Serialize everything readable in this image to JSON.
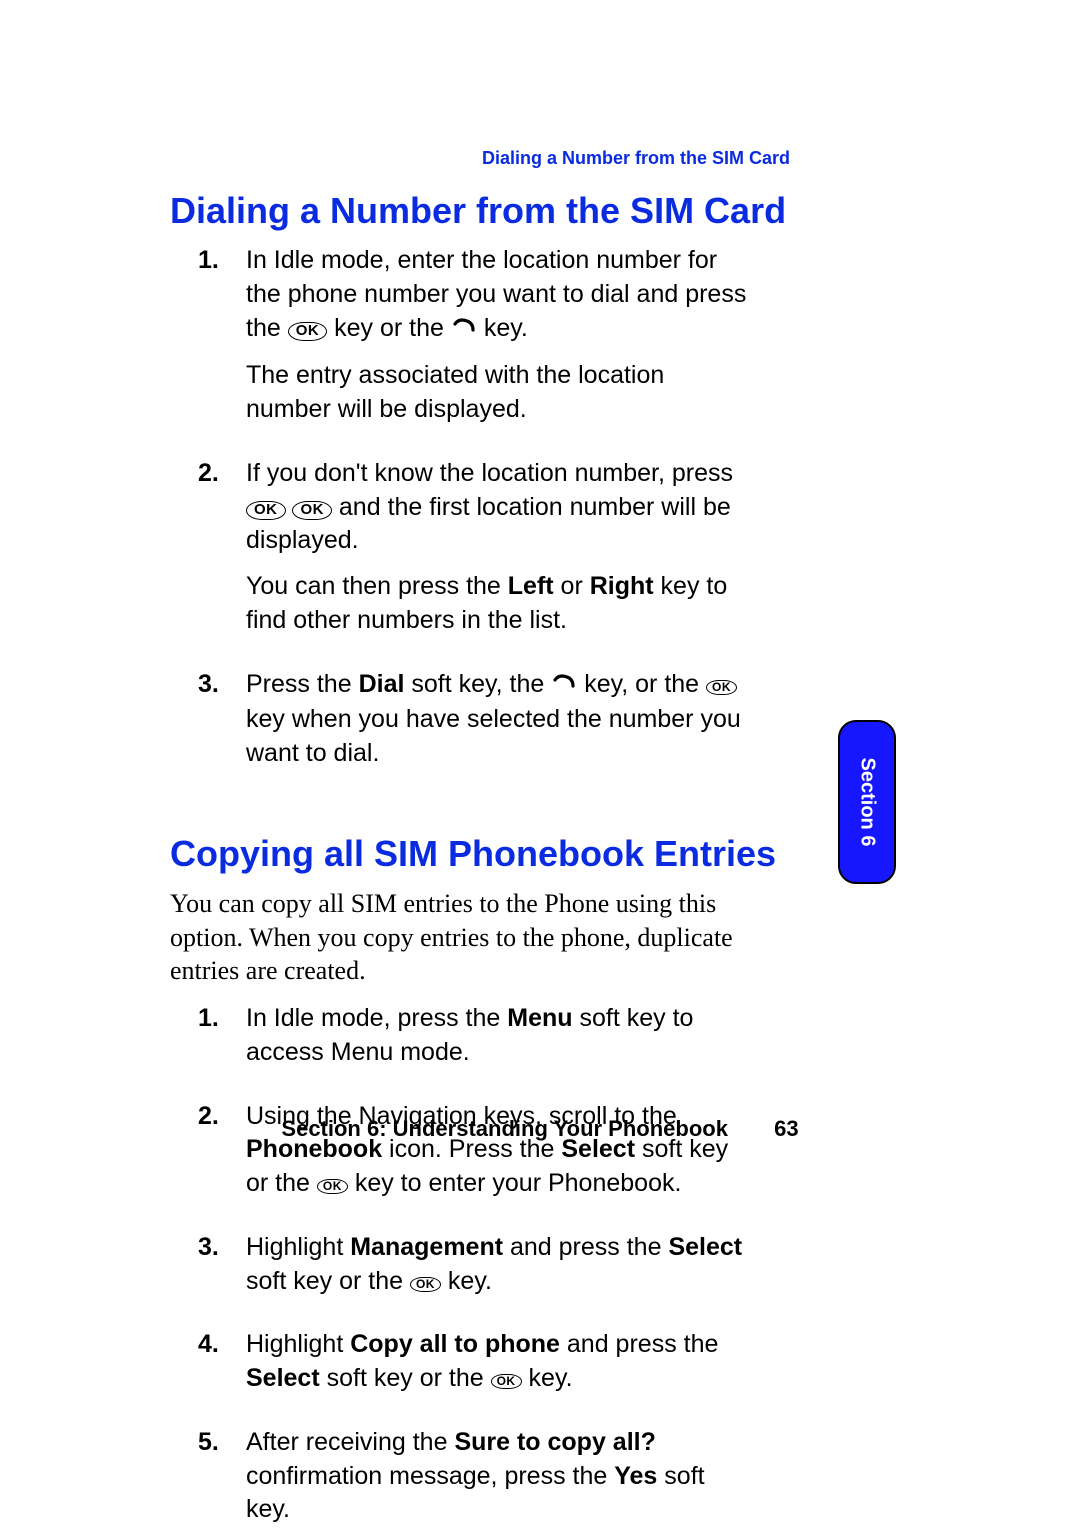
{
  "running_head": "Dialing a Number from the SIM Card",
  "section_tab": "Section 6",
  "footer_title": "Section 6: Understanding Your Phonebook",
  "footer_page": "63",
  "sec1": {
    "title": "Dialing a Number from the SIM Card",
    "steps": {
      "n1": "1.",
      "s1a": "In Idle mode, enter the location number for the phone number you want to dial and press the ",
      "s1b": " key or the ",
      "s1c": " key.",
      "s1d": "The entry associated with the location number will be displayed.",
      "n2": "2.",
      "s2a": "If you don't know the location number, press ",
      "s2b": " and the first location number will be displayed.",
      "s2c_a": "You can then press the ",
      "s2c_left": "Left",
      "s2c_or": " or ",
      "s2c_right": "Right",
      "s2c_b": " key to find other numbers in the list.",
      "n3": "3.",
      "s3a": "Press the ",
      "s3_dial": "Dial",
      "s3b": " soft key, the ",
      "s3c": " key, or the  ",
      "s3d": " key when you have selected the number you want to dial."
    }
  },
  "sec2": {
    "title": "Copying all SIM Phonebook Entries",
    "intro": "You can copy all SIM entries to the Phone using this option. When you copy entries to the phone, duplicate entries are created.",
    "steps": {
      "n1": "1.",
      "s1a": "In Idle mode, press the ",
      "s1_menu": "Menu",
      "s1b": " soft key to access Menu mode.",
      "n2": "2.",
      "s2a": "Using the Navigation keys, scroll to the ",
      "s2_pb": "Phonebook",
      "s2b": " icon. Press the ",
      "s2_sel": "Select",
      "s2c": " soft key or the ",
      "s2d": " key to enter your Phonebook.",
      "n3": "3.",
      "s3a": "Highlight ",
      "s3_mg": "Management",
      "s3b": " and press the ",
      "s3_sel": "Select",
      "s3c": " soft key or the ",
      "s3d": " key.",
      "n4": "4.",
      "s4a": "Highlight ",
      "s4_cp": "Copy all to phone",
      "s4b": " and press the ",
      "s4_sel": "Select",
      "s4c": " soft key or the ",
      "s4d": " key.",
      "n5": "5.",
      "s5a": "After receiving the ",
      "s5_conf": "Sure to copy all?",
      "s5b": " confirmation message, press the ",
      "s5_yes": "Yes",
      "s5c": " soft key."
    }
  },
  "ok_label": "OK"
}
